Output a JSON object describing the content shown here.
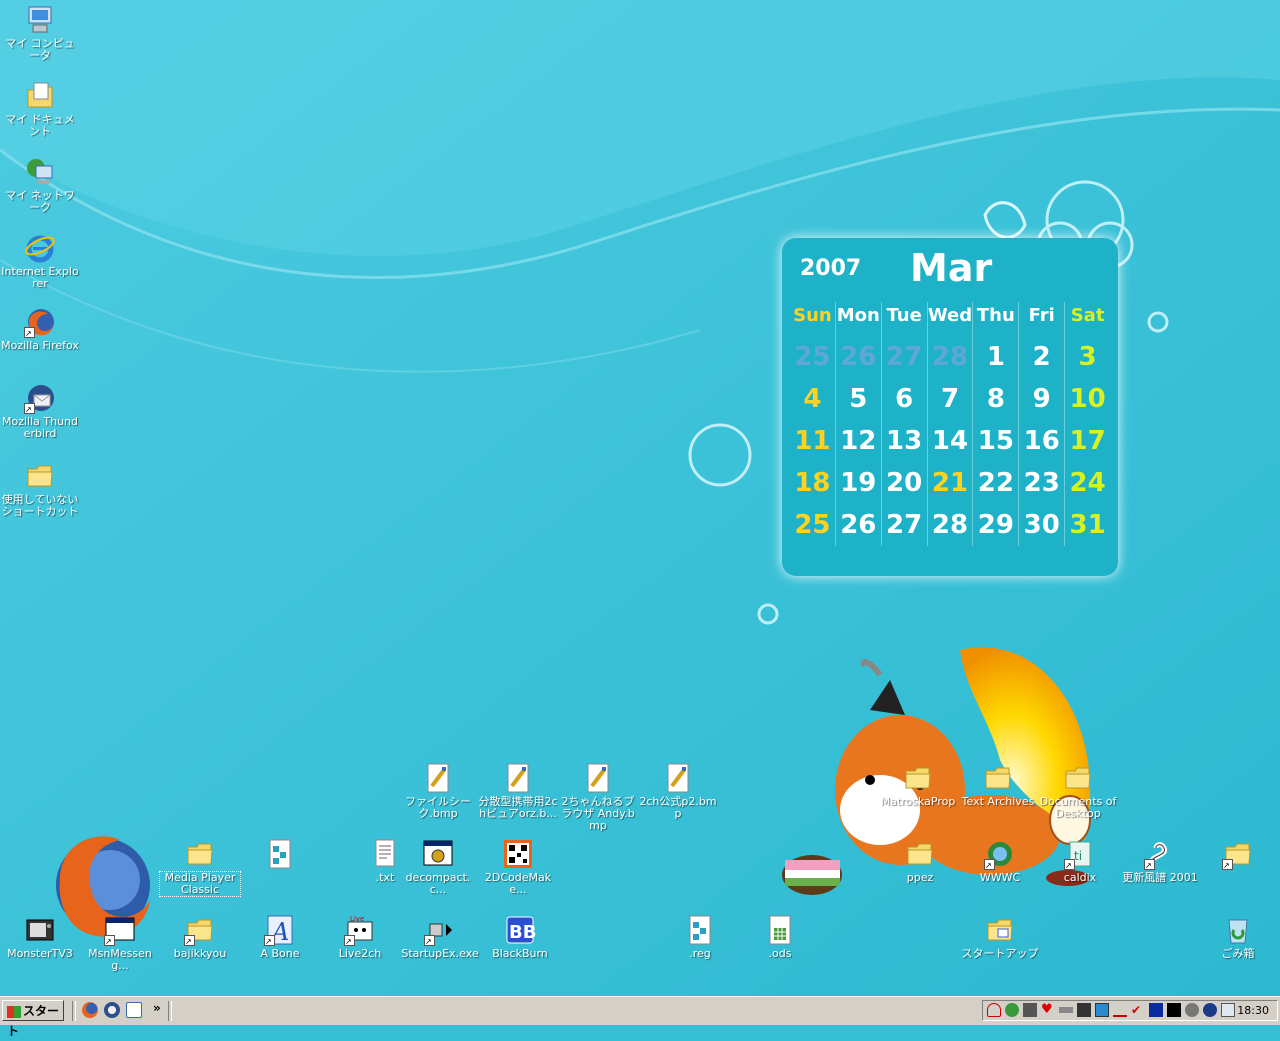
{
  "desktop": {
    "left_icons": [
      {
        "label": "マイ コンピュータ",
        "icon": "my-computer-icon"
      },
      {
        "label": "マイ ドキュメント",
        "icon": "my-documents-icon"
      },
      {
        "label": "マイ ネットワーク",
        "icon": "my-network-icon"
      },
      {
        "label": "Internet Explorer",
        "icon": "internet-explorer-icon"
      },
      {
        "label": "Mozilla Firefox",
        "icon": "firefox-icon"
      },
      {
        "label": "Mozilla Thunderbird",
        "icon": "thunderbird-icon"
      },
      {
        "label": "使用していないショートカット",
        "icon": "folder-icon"
      }
    ],
    "row1_icons": [
      {
        "label": "ファイルシーク.bmp",
        "icon": "bmp-file-icon"
      },
      {
        "label": "分散型携帯用2chビュアorz.b...",
        "icon": "bmp-file-icon"
      },
      {
        "label": "2ちゃんねるブラウザ Andy.bmp",
        "icon": "bmp-file-icon"
      },
      {
        "label": "2ch公式p2.bmp",
        "icon": "bmp-file-icon"
      },
      {
        "label": "MatroskaProp",
        "icon": "folder-icon"
      },
      {
        "label": "Text Archives",
        "icon": "folder-icon"
      },
      {
        "label": "Documents of Desktop",
        "icon": "folder-icon"
      }
    ],
    "row2_icons": [
      {
        "label": "Media Player Classic",
        "icon": "folder-icon"
      },
      {
        "label": "",
        "icon": "registry-file-icon"
      },
      {
        "label": ".txt",
        "icon": "text-file-icon"
      },
      {
        "label": "decompact.c...",
        "icon": "gear-window-icon"
      },
      {
        "label": "2DCodeMake...",
        "icon": "qr-code-icon"
      },
      {
        "label": "ppez",
        "icon": "folder-icon"
      },
      {
        "label": "WWWC",
        "icon": "wwwc-icon"
      },
      {
        "label": "caldix",
        "icon": "caldix-icon"
      },
      {
        "label": "更新風譜 2001",
        "icon": "snake-icon"
      },
      {
        "label": "",
        "icon": "folder-icon"
      }
    ],
    "row3_icons": [
      {
        "label": "MonsterTV3",
        "icon": "tv-icon"
      },
      {
        "label": "MsnMesseng...",
        "icon": "window-icon"
      },
      {
        "label": "bajikkyou",
        "icon": "folder-icon"
      },
      {
        "label": "A Bone",
        "icon": "a-bone-icon"
      },
      {
        "label": "Live2ch",
        "icon": "live2ch-icon"
      },
      {
        "label": "StartupEx.exe",
        "icon": "startup-icon"
      },
      {
        "label": "BlackBurn",
        "icon": "blackburn-icon"
      },
      {
        "label": ".reg",
        "icon": "registry-file-icon"
      },
      {
        "label": ".ods",
        "icon": "spreadsheet-icon"
      },
      {
        "label": "スタートアップ",
        "icon": "folder-icon"
      },
      {
        "label": "ごみ箱",
        "icon": "recycle-bin-icon"
      }
    ]
  },
  "calendar": {
    "year": "2007",
    "month": "Mar",
    "weekdays": [
      "Sun",
      "Mon",
      "Tue",
      "Wed",
      "Thu",
      "Fri",
      "Sat"
    ],
    "weeks": [
      [
        "25",
        "26",
        "27",
        "28",
        "1",
        "2",
        "3"
      ],
      [
        "4",
        "5",
        "6",
        "7",
        "8",
        "9",
        "10"
      ],
      [
        "11",
        "12",
        "13",
        "14",
        "15",
        "16",
        "17"
      ],
      [
        "18",
        "19",
        "20",
        "21",
        "22",
        "23",
        "24"
      ],
      [
        "25",
        "26",
        "27",
        "28",
        "29",
        "30",
        "31"
      ]
    ],
    "colors": {
      "prev_month": "#5fa8d6",
      "sunday": "#ffd21f",
      "saturday": "#d8f221",
      "holiday": "#ffd21f"
    }
  },
  "taskbar": {
    "start_label": "スタート",
    "quicklaunch_more": "»",
    "clock": "18:30"
  }
}
